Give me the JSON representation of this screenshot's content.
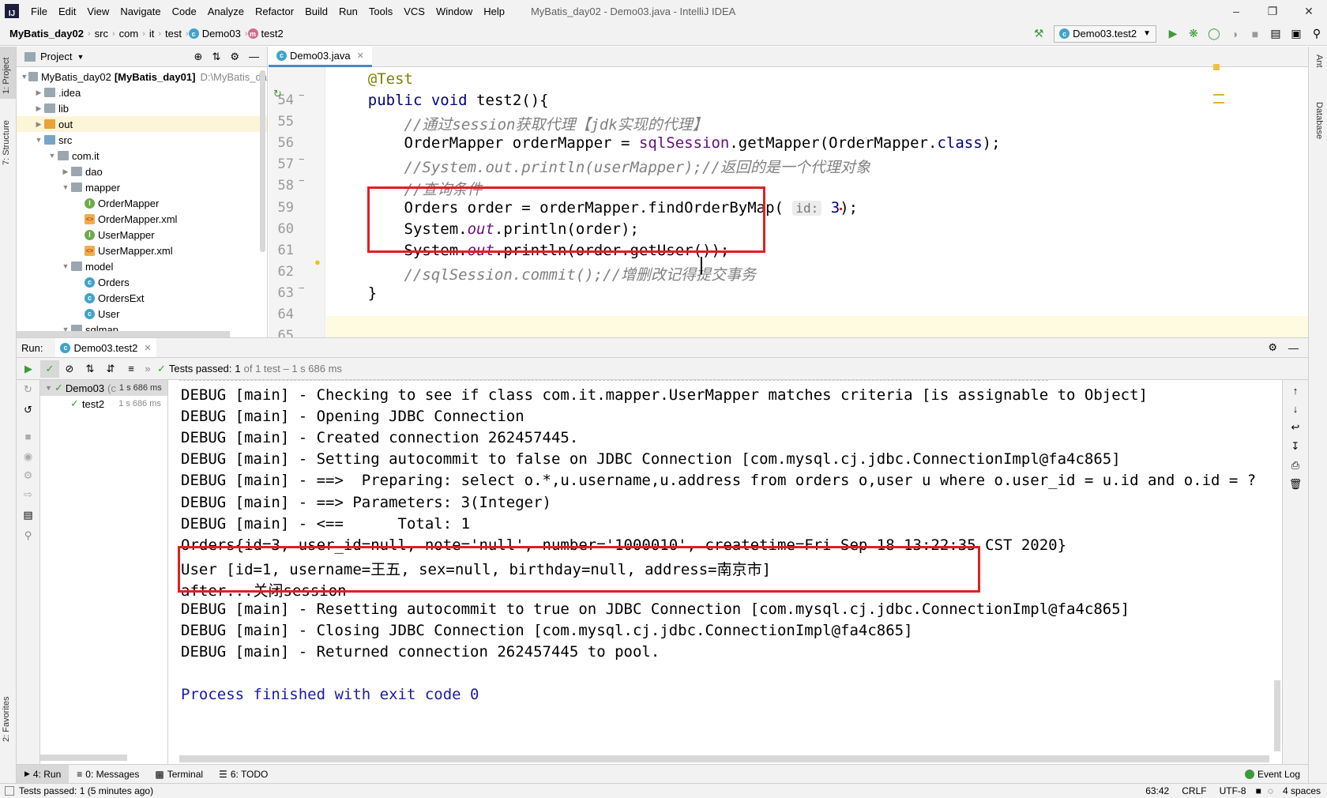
{
  "menubar": {
    "items": [
      "File",
      "Edit",
      "View",
      "Navigate",
      "Code",
      "Analyze",
      "Refactor",
      "Build",
      "Run",
      "Tools",
      "VCS",
      "Window",
      "Help"
    ],
    "window_title": "MyBatis_day02 - Demo03.java - IntelliJ IDEA",
    "logo": "IJ"
  },
  "navbar": {
    "breadcrumbs": [
      "MyBatis_day02",
      "src",
      "com",
      "it",
      "test",
      "Demo03",
      "test2"
    ],
    "run_config": "Demo03.test2"
  },
  "left_strip": {
    "tabs": [
      "1: Project",
      "7: Structure",
      "2: Favorites"
    ]
  },
  "right_strip": {
    "tabs": [
      "Ant",
      "Database"
    ]
  },
  "project": {
    "header": "Project",
    "tree": [
      {
        "label": "MyBatis_day02",
        "bold": "[MyBatis_day01]",
        "path": "D:\\MyBatis_da",
        "depth": 0,
        "icon": "module",
        "open": true
      },
      {
        "label": ".idea",
        "depth": 1,
        "icon": "folder-grey",
        "open": false
      },
      {
        "label": "lib",
        "depth": 1,
        "icon": "folder-grey",
        "open": false
      },
      {
        "label": "out",
        "depth": 1,
        "icon": "folder-orange",
        "open": false
      },
      {
        "label": "src",
        "depth": 1,
        "icon": "folder-blue",
        "open": true
      },
      {
        "label": "com.it",
        "depth": 2,
        "icon": "folder-grey",
        "open": true
      },
      {
        "label": "dao",
        "depth": 3,
        "icon": "folder-grey",
        "open": false
      },
      {
        "label": "mapper",
        "depth": 3,
        "icon": "folder-grey",
        "open": true
      },
      {
        "label": "OrderMapper",
        "depth": 4,
        "icon": "iface"
      },
      {
        "label": "OrderMapper.xml",
        "depth": 4,
        "icon": "xml"
      },
      {
        "label": "UserMapper",
        "depth": 4,
        "icon": "iface"
      },
      {
        "label": "UserMapper.xml",
        "depth": 4,
        "icon": "xml"
      },
      {
        "label": "model",
        "depth": 3,
        "icon": "folder-grey",
        "open": true
      },
      {
        "label": "Orders",
        "depth": 4,
        "icon": "class"
      },
      {
        "label": "OrdersExt",
        "depth": 4,
        "icon": "class"
      },
      {
        "label": "User",
        "depth": 4,
        "icon": "class"
      },
      {
        "label": "sqlmap",
        "depth": 3,
        "icon": "folder-grey",
        "open": true
      }
    ]
  },
  "editor": {
    "tab": "Demo03.java",
    "lines": [
      {
        "n": "54",
        "code": "    @Test"
      },
      {
        "n": "55",
        "code": "    public void test2(){"
      },
      {
        "n": "56",
        "code": "        //通过session获取代理【jdk实现的代理】"
      },
      {
        "n": "57",
        "code": "        OrderMapper orderMapper = sqlSession.getMapper(OrderMapper.class);"
      },
      {
        "n": "58",
        "code": "        //System.out.println(userMapper);//返回的是一个代理对象"
      },
      {
        "n": "59",
        "code": "        //查询条件"
      },
      {
        "n": "60",
        "code": "        Orders order = orderMapper.findOrderByMap( id: 3);"
      },
      {
        "n": "61",
        "code": "        System.out.println(order);"
      },
      {
        "n": "62",
        "code": "        System.out.println(order.getUser());"
      },
      {
        "n": "63",
        "code": "        //sqlSession.commit();//增删改记得提交事务"
      },
      {
        "n": "64",
        "code": "    }"
      },
      {
        "n": "65",
        "code": ""
      }
    ],
    "param_hint": "id:"
  },
  "run": {
    "label": "Run:",
    "tab": "Demo03.test2",
    "status_prefix": "Tests passed:",
    "status_count": "1",
    "status_suffix": "of 1 test – 1 s 686 ms",
    "tree": [
      {
        "label": "Demo03",
        "detail": "(c",
        "time": "1 s 686 ms"
      },
      {
        "label": "test2",
        "time": "1 s 686 ms"
      }
    ],
    "console": [
      "DEBUG [main] - Checking to see if class com.it.mapper.UserMapper matches criteria [is assignable to Object]",
      "DEBUG [main] - Opening JDBC Connection",
      "DEBUG [main] - Created connection 262457445.",
      "DEBUG [main] - Setting autocommit to false on JDBC Connection [com.mysql.cj.jdbc.ConnectionImpl@fa4c865]",
      "DEBUG [main] - ==>  Preparing: select o.*,u.username,u.address from orders o,user u where o.user_id = u.id and o.id = ?",
      "DEBUG [main] - ==> Parameters: 3(Integer)",
      "DEBUG [main] - <==      Total: 1",
      "Orders{id=3, user_id=null, note='null', number='1000010', createtime=Fri Sep 18 13:22:35 CST 2020}",
      "User [id=1, username=王五, sex=null, birthday=null, address=南京市]",
      "after...关闭session",
      "DEBUG [main] - Resetting autocommit to true on JDBC Connection [com.mysql.cj.jdbc.ConnectionImpl@fa4c865]",
      "DEBUG [main] - Closing JDBC Connection [com.mysql.cj.jdbc.ConnectionImpl@fa4c865]",
      "DEBUG [main] - Returned connection 262457445 to pool.",
      "",
      "Process finished with exit code 0"
    ]
  },
  "bottom_tools": {
    "items": [
      "4: Run",
      "0: Messages",
      "Terminal",
      "6: TODO"
    ],
    "event_log": "Event Log"
  },
  "status": {
    "message": "Tests passed: 1 (5 minutes ago)",
    "position": "63:42",
    "line_sep": "CRLF",
    "encoding": "UTF-8",
    "indent": "4 spaces"
  },
  "colors": {
    "highlight_box": "#e02020",
    "keyword": "#000080",
    "comment": "#808080",
    "annotation": "#808000",
    "pass_green": "#3c9a3c"
  }
}
